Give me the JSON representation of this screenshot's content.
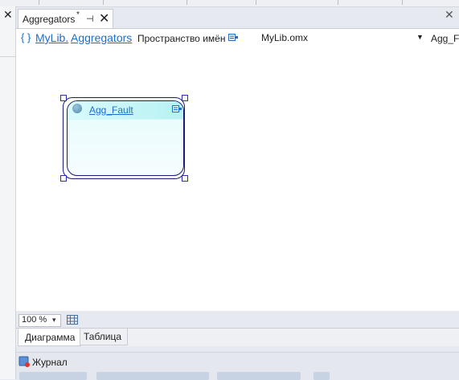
{
  "document_tab": {
    "title": "Aggregators",
    "modified_marker": "*",
    "pin_glyph": "⊣",
    "close_glyph": "✕"
  },
  "left_panel": {
    "close_glyph": "✕"
  },
  "right_panel": {
    "close_glyph": "✕"
  },
  "breadcrumb": {
    "brace": "{ }",
    "namespace_part1": "MyLib.",
    "namespace_part2": "Aggregators",
    "namespace_label": "Пространство имён",
    "file_name": "MyLib.omx",
    "file_arrow": "▼",
    "aggregate_crumb": "Agg_Fa"
  },
  "diagram": {
    "entity": {
      "name": "Agg_Fault"
    }
  },
  "zoom": {
    "value": "100 %",
    "arrow": "▾"
  },
  "view_tabs": [
    {
      "label": "Диаграмма",
      "selected": true
    },
    {
      "label": "Таблица",
      "selected": false
    }
  ],
  "journal": {
    "label": "Журнал"
  },
  "colors": {
    "link": "#1e6fc8",
    "entity_border": "#1a1a78",
    "handle_border": "#2b2bb5",
    "entity_header": "#bff0f3"
  }
}
